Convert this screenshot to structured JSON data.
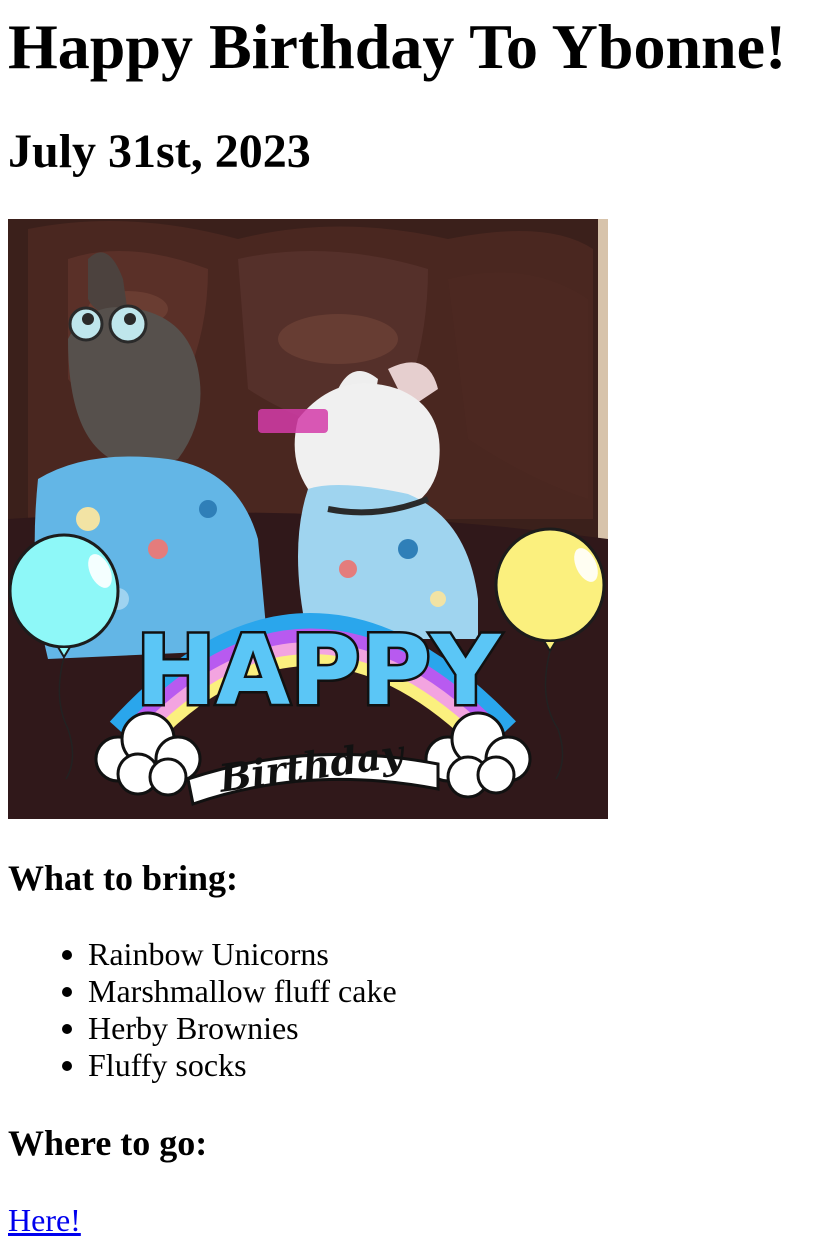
{
  "page": {
    "title": "Happy Birthday To Ybonne!",
    "date": "July 31st, 2023"
  },
  "hero_image": {
    "banner_word": "HAPPY",
    "banner_script": "Birthday",
    "colors": {
      "chair": "#3b201b",
      "shirt": "#63b6e6",
      "balloon_left": "#8ef8f8",
      "balloon_right": "#fbf07e",
      "banner_text": "#5bc6f6"
    }
  },
  "bring": {
    "heading": "What to bring:",
    "items": [
      "Rainbow Unicorns",
      "Marshmallow fluff cake",
      "Herby Brownies",
      "Fluffy socks"
    ]
  },
  "go": {
    "heading": "Where to go:",
    "link_text": "Here!"
  }
}
